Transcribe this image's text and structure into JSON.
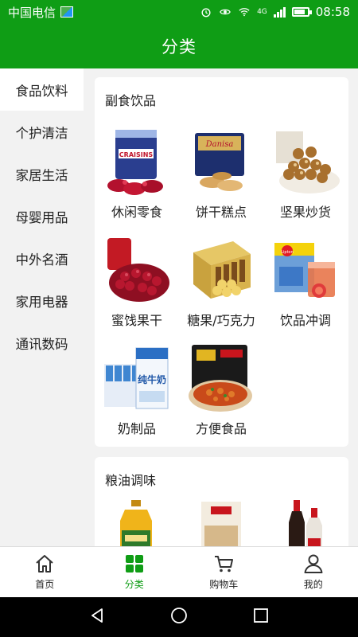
{
  "status_bar": {
    "carrier": "中国电信",
    "network": "4G",
    "time": "08:58"
  },
  "header": {
    "title": "分类"
  },
  "sidebar": {
    "items": [
      {
        "label": "食品饮料",
        "active": true
      },
      {
        "label": "个护清洁",
        "active": false
      },
      {
        "label": "家居生活",
        "active": false
      },
      {
        "label": "母婴用品",
        "active": false
      },
      {
        "label": "中外名酒",
        "active": false
      },
      {
        "label": "家用电器",
        "active": false
      },
      {
        "label": "通讯数码",
        "active": false
      }
    ]
  },
  "sections": [
    {
      "title": "副食饮品",
      "items": [
        {
          "label": "休闲零食",
          "icon": "cranberry-snack-bag-image"
        },
        {
          "label": "饼干糕点",
          "icon": "danisa-cookie-tin-image"
        },
        {
          "label": "坚果炒货",
          "icon": "macadamia-nuts-bowl-image"
        },
        {
          "label": "蜜饯果干",
          "icon": "dried-cranberries-image"
        },
        {
          "label": "糖果/巧克力",
          "icon": "chocolate-box-image"
        },
        {
          "label": "饮品冲调",
          "icon": "lipton-tea-image"
        },
        {
          "label": "奶制品",
          "icon": "milk-cartons-image"
        },
        {
          "label": "方便食品",
          "icon": "instant-noodles-image"
        }
      ]
    },
    {
      "title": "粮油调味",
      "items": [
        {
          "label": "",
          "icon": "cooking-oil-bottle-image"
        },
        {
          "label": "",
          "icon": "rice-bag-image"
        },
        {
          "label": "",
          "icon": "soy-sauce-bottles-image"
        }
      ]
    }
  ],
  "tabbar": {
    "tabs": [
      {
        "label": "首页",
        "icon": "home-icon"
      },
      {
        "label": "分类",
        "icon": "category-grid-icon"
      },
      {
        "label": "购物车",
        "icon": "cart-icon"
      },
      {
        "label": "我的",
        "icon": "user-icon"
      }
    ]
  },
  "colors": {
    "brand_green": "#0f9d15",
    "background": "#f2f2f2",
    "card": "#ffffff"
  }
}
